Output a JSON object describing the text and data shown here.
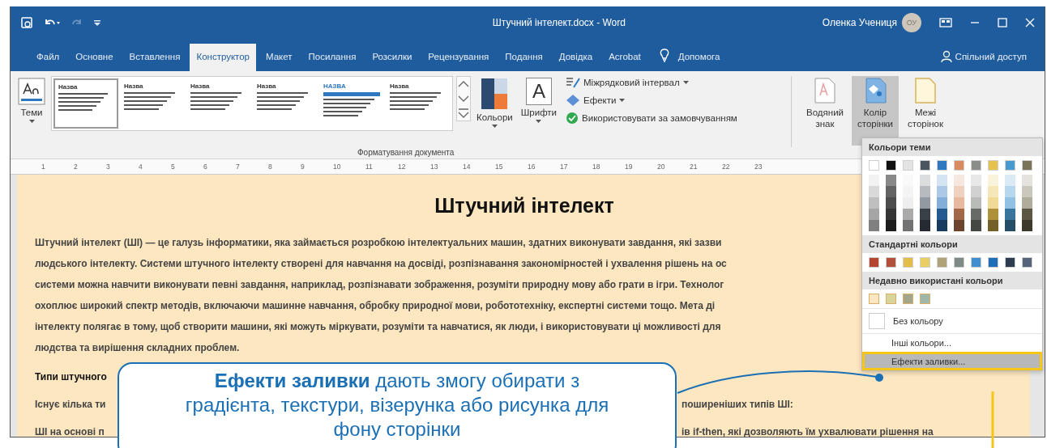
{
  "window": {
    "title": "Штучний інтелект.docx - Word",
    "user": "Оленка Учениця",
    "avatar": "ОУ"
  },
  "tabs": [
    {
      "label": "Файл",
      "selected": false
    },
    {
      "label": "Основне",
      "selected": false
    },
    {
      "label": "Вставлення",
      "selected": false
    },
    {
      "label": "Конструктор",
      "selected": true
    },
    {
      "label": "Макет",
      "selected": false
    },
    {
      "label": "Посилання",
      "selected": false
    },
    {
      "label": "Розсилки",
      "selected": false
    },
    {
      "label": "Рецензування",
      "selected": false
    },
    {
      "label": "Подання",
      "selected": false
    },
    {
      "label": "Довідка",
      "selected": false
    },
    {
      "label": "Acrobat",
      "selected": false
    }
  ],
  "help": "Допомога",
  "share": "Спільний доступ",
  "ribbon": {
    "themes": "Теми",
    "styles": [
      {
        "title": "Назва",
        "selected": true
      },
      {
        "title": "Назва",
        "selected": false
      },
      {
        "title": "Назва",
        "selected": false
      },
      {
        "title": "Назва",
        "selected": false
      },
      {
        "title": "НАЗВА",
        "selected": false
      },
      {
        "title": "Назва",
        "selected": false
      }
    ],
    "colors": "Кольори",
    "fonts": "Шрифти",
    "fonts_glyph": "A",
    "options": [
      {
        "label": "Міжрядковий інтервал",
        "kind": "spacing"
      },
      {
        "label": "Ефекти",
        "kind": "effects"
      },
      {
        "label": "Використовувати за замовчуванням",
        "kind": "default"
      }
    ],
    "group_label": "Форматування документа",
    "page_buttons": [
      {
        "label": "Водяний знак",
        "kind": "watermark",
        "selected": false
      },
      {
        "label": "Колір сторінки",
        "kind": "page-color",
        "selected": true
      },
      {
        "label": "Межі сторінок",
        "kind": "borders",
        "selected": false
      }
    ]
  },
  "ruler": [
    "1",
    "2",
    "3",
    "4",
    "5",
    "6",
    "7",
    "8",
    "9",
    "10",
    "11",
    "12",
    "13",
    "14",
    "15",
    "16",
    "17",
    "18",
    "19",
    "20",
    "21",
    "22",
    "23"
  ],
  "document": {
    "title": "Штучний інтелект",
    "lines": [
      "Штучний інтелект (ШІ) — це галузь інформатики, яка займається розробкою інтелектуальних машин, здатних виконувати завдання, які зазви",
      "людського інтелекту. Системи штучного інтелекту створені для навчання на досвіді, розпізнавання закономірностей і ухвалення рішень на ос",
      "системи можна навчити виконувати певні завдання, наприклад, розпізнавати зображення, розуміти природну мову або грати в ігри. Технолог",
      "охоплює широкий спектр методів, включаючи машинне навчання, обробку природної мови, робототехніку, експертні системи тощо. Мета ді",
      "інтелекту полягає в тому, щоб створити машини, які можуть міркувати, розуміти та навчатися, як люди, і використовувати ці можливості для",
      "людства та вирішення складних проблем."
    ],
    "partial_rows": [
      {
        "left": "Типи штучного",
        "bold": true
      },
      {
        "left": "Існує кілька ти",
        "right": "поширеніших типів ШІ:",
        "bold": false
      },
      {
        "left": "ШІ на основі п",
        "right": "ів if-then, які дозволяють їм ухвалювати рішення на",
        "bold": false
      }
    ]
  },
  "page_color_menu": {
    "theme_header": "Кольори теми",
    "theme_colors": [
      {
        "color": "#ffffff"
      },
      {
        "color": "#111111"
      },
      {
        "color": "#e3e3e3"
      },
      {
        "color": "#4a5560"
      },
      {
        "color": "#2e78c0"
      },
      {
        "color": "#d98a5e"
      },
      {
        "color": "#8a8d8a"
      },
      {
        "color": "#e8c24e"
      },
      {
        "color": "#4a9ad0"
      },
      {
        "color": "#7a7458"
      }
    ],
    "standard_header": "Стандартні кольори",
    "standard_colors": [
      {
        "color": "#b5452f"
      },
      {
        "color": "#b3503a"
      },
      {
        "color": "#e3bd4a"
      },
      {
        "color": "#e9cf63"
      },
      {
        "color": "#b0a37a"
      },
      {
        "color": "#7d8a85"
      },
      {
        "color": "#3f8fd0"
      },
      {
        "color": "#1f6fb8"
      },
      {
        "color": "#2d3c4e"
      },
      {
        "color": "#56657a"
      }
    ],
    "recent_header": "Недавно використані кольори",
    "recent_colors": [
      {
        "color": "#fce6bf"
      },
      {
        "color": "#d8d59b"
      },
      {
        "color": "#a4a68b"
      },
      {
        "color": "#9fb6a9"
      }
    ],
    "items": [
      {
        "label": "Без кольору",
        "kind": "none",
        "selected": false
      },
      {
        "label": "Інші кольори...",
        "kind": "more",
        "selected": false
      },
      {
        "label": "Ефекти заливки...",
        "kind": "effects",
        "selected": true
      }
    ]
  },
  "callout": {
    "text": "**Ефекти заливки** дають змогу обирати з градієнта, текстури, візерунка або рисунка для фону сторінки"
  }
}
